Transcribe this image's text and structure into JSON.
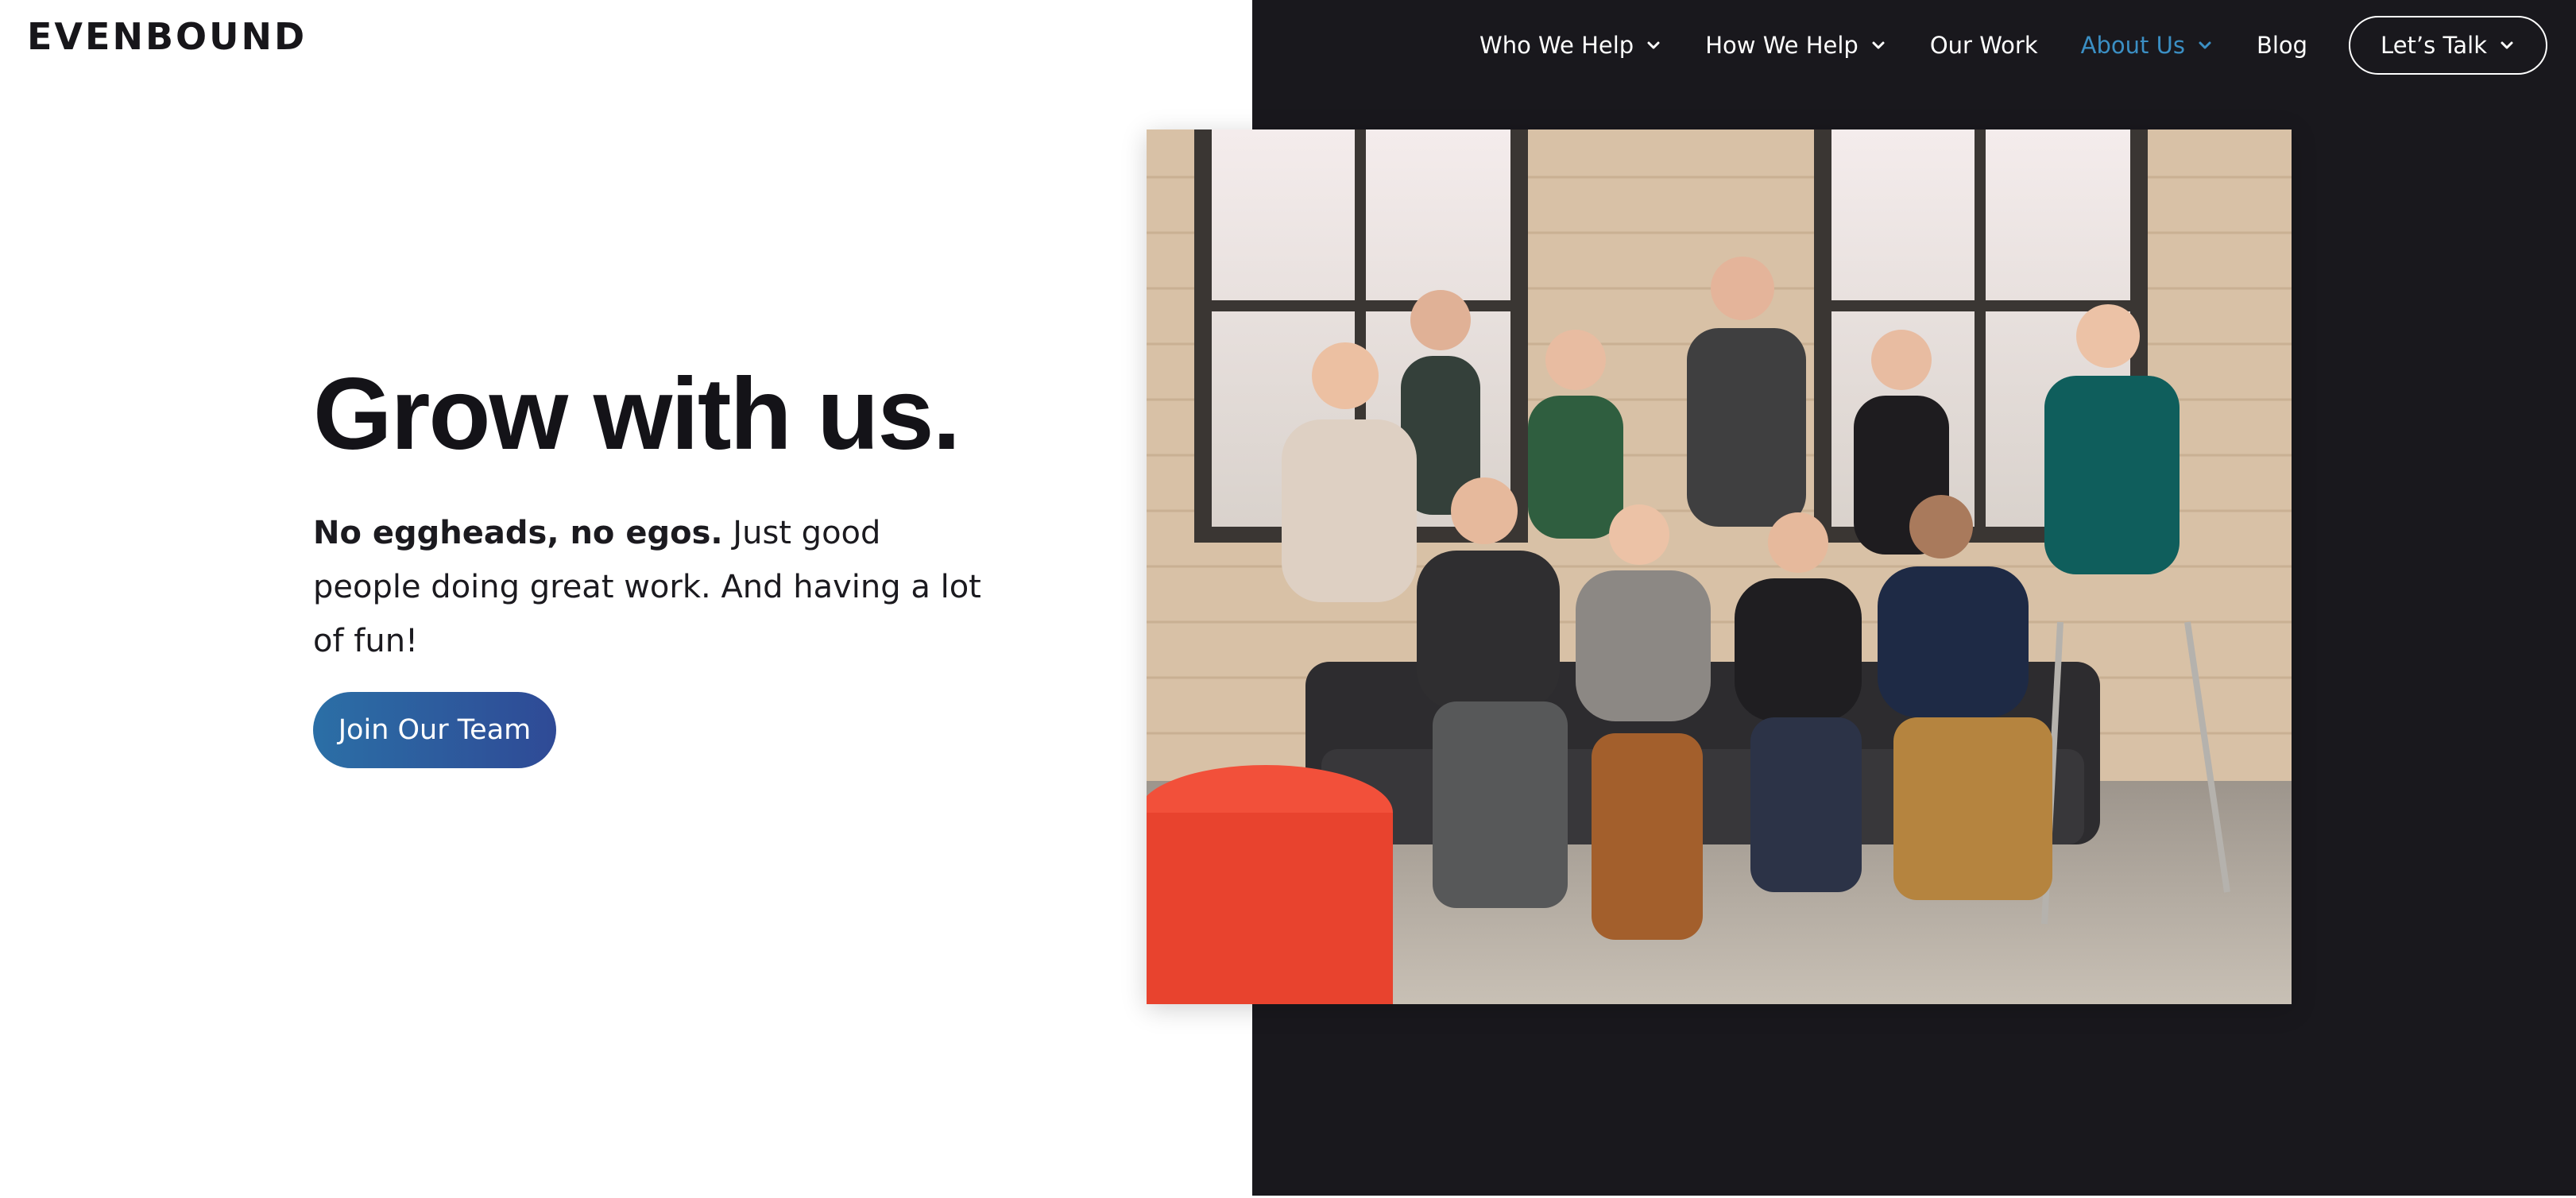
{
  "brand": {
    "logo_text": "EVENBOUND"
  },
  "nav": {
    "items": [
      {
        "label": "Who We Help",
        "has_dropdown": true,
        "active": false
      },
      {
        "label": "How We Help",
        "has_dropdown": true,
        "active": false
      },
      {
        "label": "Our Work",
        "has_dropdown": false,
        "active": false
      },
      {
        "label": "About Us",
        "has_dropdown": true,
        "active": true
      },
      {
        "label": "Blog",
        "has_dropdown": false,
        "active": false
      }
    ],
    "cta_label": "Let’s Talk"
  },
  "hero": {
    "title": "Grow with us.",
    "subtitle_bold": "No eggheads, no egos.",
    "subtitle_rest": " Just good people doing great work. And having a lot of fun!",
    "button_label": "Join Our Team"
  },
  "photo": {
    "subject": "team-group-photo"
  },
  "colors": {
    "dark_panel": "#19181d",
    "active_nav": "#3b8fc4",
    "button_gradient_start": "#2b6fa6",
    "button_gradient_end": "#2f4a96"
  },
  "icons": {
    "dropdown": "chevron-down-icon"
  }
}
